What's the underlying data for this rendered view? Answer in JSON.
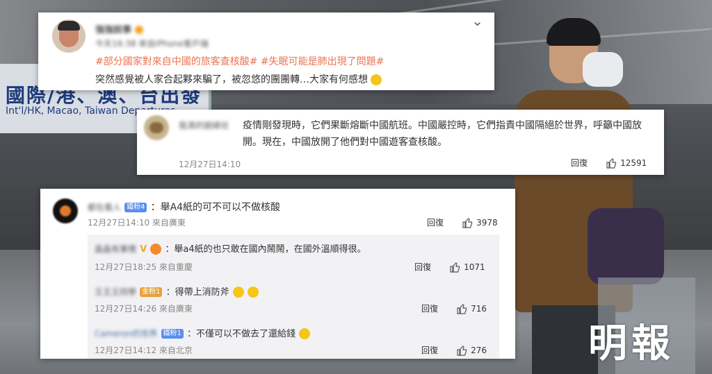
{
  "post": {
    "username": "強強說事",
    "meta": "今天16:38 來自iPhone客戶端",
    "topics": "#部分國家對來自中國的旅客查核酸# #失眠可能是肺出現了問題#",
    "text": "突然感覺被人家合起夥來騙了，被忽悠的團團轉…大家有何感想",
    "chevron": "⌄"
  },
  "comment1": {
    "username": "我滴的媳婦兒",
    "text": "疫情剛發現時，它們果斷熔斷中國航班。中國嚴控時，它們指責中國隔絕於世界，呼籲中國放開。現在，中國放開了他們對中國遊客查核酸。",
    "time": "12月27日14:10",
    "reply_label": "回復",
    "likes": "12591"
  },
  "comment2": {
    "username": "都在看人",
    "badge": "鐵粉4",
    "text": "：舉A4紙的可不可以不做核酸",
    "time": "12月27日14:10 來自廣東",
    "reply_label": "回復",
    "likes": "3978"
  },
  "replies": [
    {
      "username": "晶晶有事情",
      "badge": "",
      "text": "：舉a4紙的也只敢在國內鬧鬧，在國外溫順得很。",
      "time": "12月27日18:25 來自重慶",
      "reply_label": "回復",
      "likes": "1071"
    },
    {
      "username": "王王王同學",
      "badge": "金粉1",
      "text": "：得帶上消防斧",
      "time": "12月27日14:26 來自廣東",
      "reply_label": "回復",
      "likes": "716"
    },
    {
      "username": "Cameron的世界",
      "badge": "鐵粉1",
      "text": "：不僅可以不做去了還給錢",
      "time": "12月27日14:12 來自北京",
      "reply_label": "回復",
      "likes": "276"
    }
  ],
  "background_sign": {
    "line1": "國際/港、澳、台出發",
    "line2": "Int'l/HK, Macao, Taiwan Departures"
  },
  "logo": "明報",
  "colors": {
    "topic": "#eb7350",
    "badge_blue": "#5b8def",
    "badge_gold": "#e6a23c"
  }
}
